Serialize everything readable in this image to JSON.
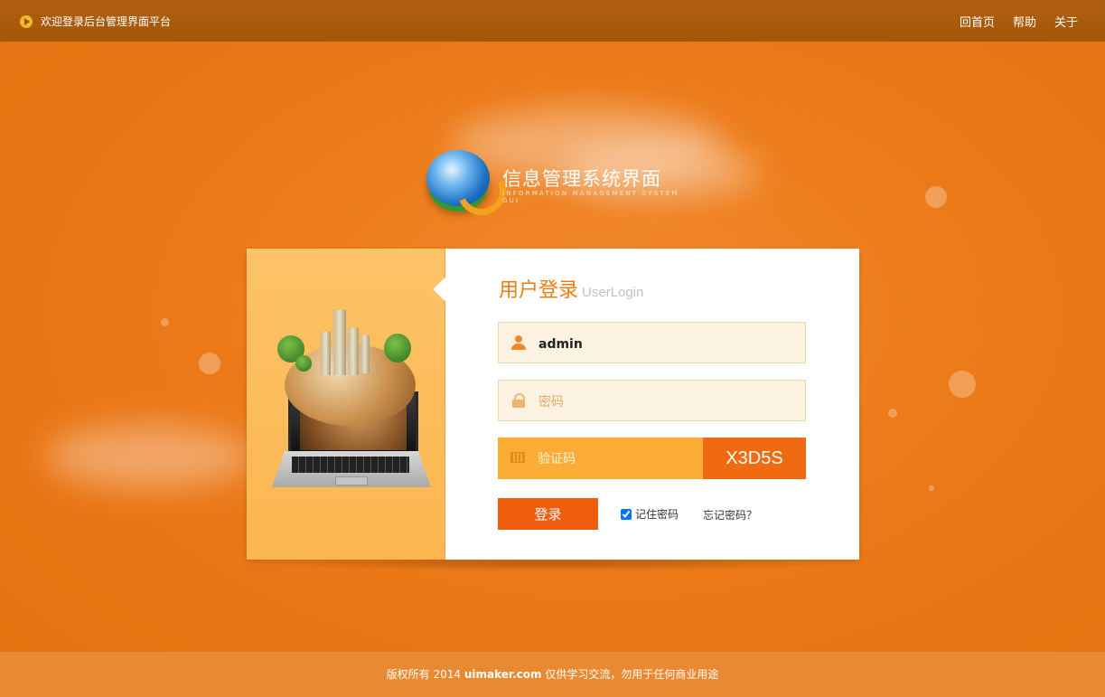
{
  "header": {
    "welcome_text": "欢迎登录后台管理界面平台",
    "nav": [
      "回首页",
      "帮助",
      "关于"
    ]
  },
  "logo": {
    "title": "信息管理系统界面",
    "subtitle": "INFORMATION MANAGEMENT SYSTEM GUI"
  },
  "login": {
    "title_cn": "用户登录",
    "title_en": "UserLogin",
    "username_value": "admin",
    "password_placeholder": "密码",
    "captcha_placeholder": "验证码",
    "captcha_code": "X3D5S",
    "submit_label": "登录",
    "remember_label": "记住密码",
    "remember_checked": true,
    "forgot_label": "忘记密码？"
  },
  "footer": {
    "prefix": "版权所有 2014",
    "site": "uimaker.com",
    "suffix": "仅供学习交流，勿用于任何商业用途"
  },
  "colors": {
    "background": "#ec7a18",
    "topbar": "#a65a0b",
    "accent": "#ef5d0f",
    "captcha_bg": "#fbac35",
    "footer": "#e98a33"
  }
}
